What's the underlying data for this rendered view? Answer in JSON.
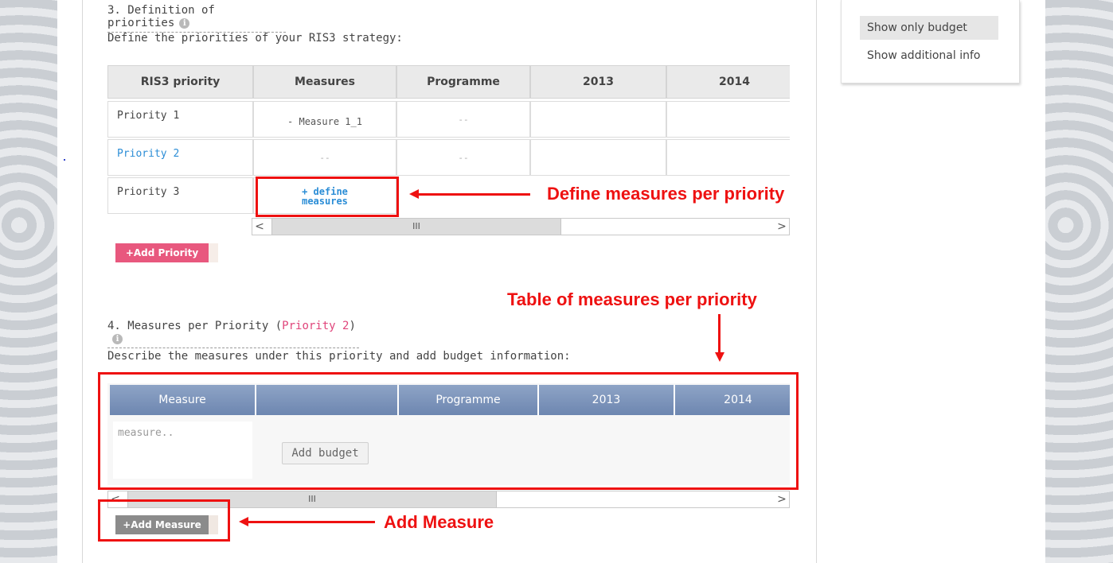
{
  "section3": {
    "title": "3. Definition of priorities",
    "info_icon": "info-icon",
    "description": "Define the priorities of your RIS3 strategy:",
    "columns": [
      "RIS3 priority",
      "Measures",
      "Programme",
      "2013",
      "2014"
    ],
    "rows": [
      {
        "priority": "Priority 1",
        "measure": "- Measure 1_1",
        "programme": "--"
      },
      {
        "priority": "Priority 2",
        "measure": "--",
        "programme": "--"
      },
      {
        "priority": "Priority 3",
        "measure": "+ define measures"
      }
    ],
    "scrollbar": {
      "left_arrow": "<",
      "thumb_grip": "III",
      "right_arrow": ">"
    },
    "add_priority_label": "+Add Priority"
  },
  "section4": {
    "title_prefix": "4. Measures per Priority (",
    "title_priority": "Priority 2",
    "title_suffix": ")",
    "description": "Describe the measures under this priority and add budget information:",
    "columns": [
      "Measure",
      "",
      "Programme",
      "2013",
      "2014"
    ],
    "measure_placeholder": "measure..",
    "add_budget_label": "Add budget",
    "scrollbar": {
      "left_arrow": "<",
      "thumb_grip": "III",
      "right_arrow": ">"
    },
    "add_measure_label": "+Add Measure"
  },
  "side_panel": {
    "items": [
      "Show only budget",
      "Show additional info"
    ],
    "selected_index": 0
  },
  "annotations": {
    "define_measures": "Define measures per priority",
    "table_of_measures": "Table of measures per priority",
    "add_measure": "Add Measure"
  },
  "colors": {
    "annotation_red": "#ee1111",
    "add_priority_pink": "#e8587e",
    "link_blue": "#2b8dd6",
    "header_blue": "#7b92ba",
    "add_measure_gray": "#8b8b8b"
  }
}
